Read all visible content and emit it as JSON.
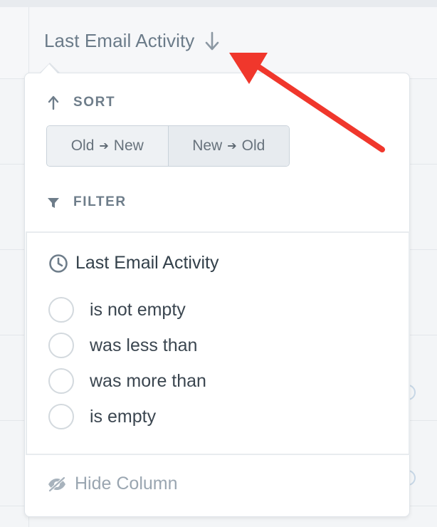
{
  "column_header": {
    "label": "Last Email Activity",
    "sort_icon": "arrow-down-icon"
  },
  "dropdown": {
    "sort": {
      "heading": "SORT",
      "icon": "arrow-up-icon",
      "options": [
        {
          "from": "Old",
          "to": "New"
        },
        {
          "from": "New",
          "to": "Old"
        }
      ],
      "selected_index": 1
    },
    "filter": {
      "heading": "FILTER",
      "icon": "funnel-icon",
      "field_title": "Last Email Activity",
      "field_icon": "clock-icon",
      "options": [
        "is not empty",
        "was less than",
        "was more than",
        "is empty"
      ]
    },
    "hide_column": {
      "label": "Hide Column",
      "icon": "eye-off-icon"
    }
  },
  "colors": {
    "annotation_arrow": "#f0372c",
    "text_muted": "#6b7b89",
    "text_dark": "#33404a"
  }
}
